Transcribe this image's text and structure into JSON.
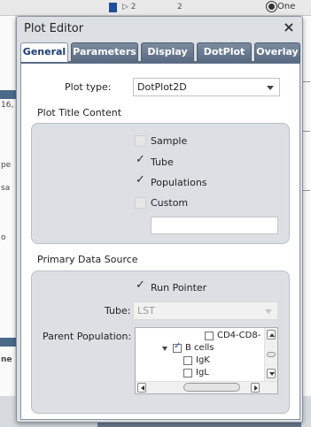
{
  "background": {
    "top_cells": [
      "▷ 2",
      "2"
    ],
    "top_right_label": "One",
    "left_fragments": [
      "16,",
      "pe",
      "sa",
      "o",
      "ne"
    ]
  },
  "dialog": {
    "title": "Plot Editor",
    "close_glyph": "×",
    "tabs": [
      {
        "label": "General",
        "active": true
      },
      {
        "label": "Parameters",
        "active": false
      },
      {
        "label": "Display",
        "active": false
      },
      {
        "label": "DotPlot",
        "active": false
      },
      {
        "label": "Overlay",
        "active": false
      }
    ],
    "general": {
      "plot_type_label": "Plot type:",
      "plot_type_value": "DotPlot2D",
      "plot_title_content_label": "Plot Title Content",
      "title_options": [
        {
          "label": "Sample",
          "checked": false
        },
        {
          "label": "Tube",
          "checked": true
        },
        {
          "label": "Populations",
          "checked": true
        },
        {
          "label": "Custom",
          "checked": false
        }
      ],
      "custom_title_value": "",
      "primary_data_source_label": "Primary Data Source",
      "run_pointer": {
        "label": "Run Pointer",
        "checked": true
      },
      "tube_label": "Tube:",
      "tube_value": "LST",
      "parent_population_label": "Parent Population:",
      "parent_population_items": [
        {
          "label": "CD4-CD8-",
          "checked": false,
          "level": 2
        },
        {
          "label": "B cells",
          "checked": true,
          "level": 1,
          "expanded": true
        },
        {
          "label": "IgK",
          "checked": false,
          "level": 2
        },
        {
          "label": "IgL",
          "checked": false,
          "level": 2
        }
      ]
    }
  },
  "check_glyph": "✓"
}
